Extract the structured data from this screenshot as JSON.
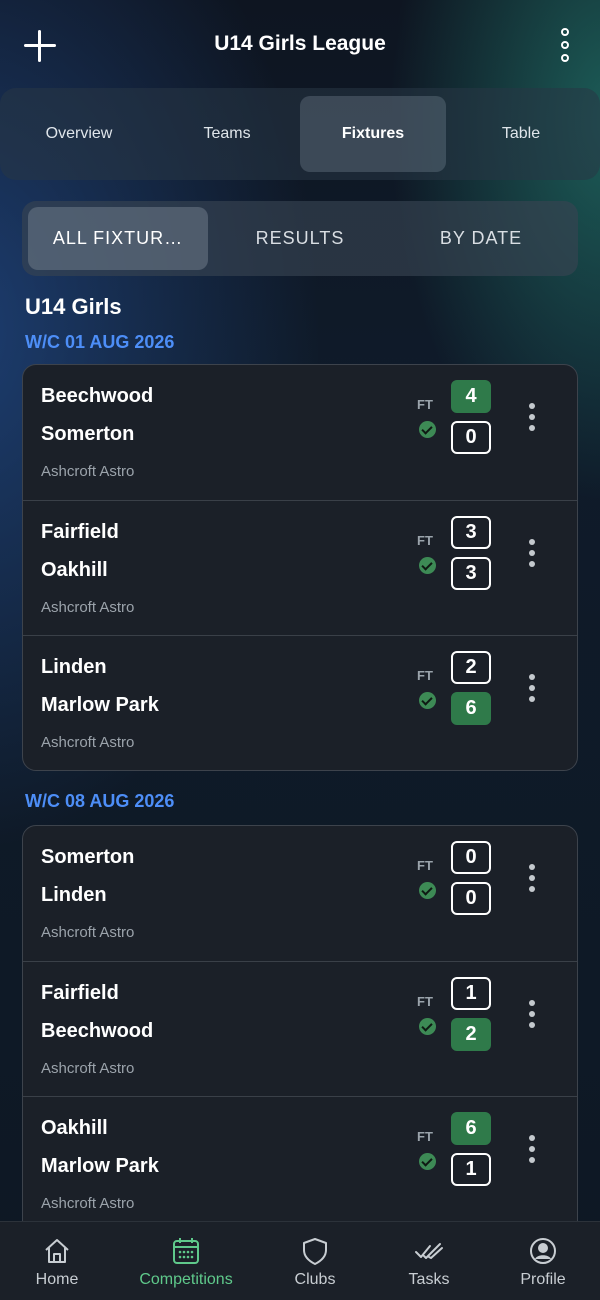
{
  "header": {
    "title": "U14 Girls League"
  },
  "tabs": [
    {
      "label": "Overview",
      "active": false
    },
    {
      "label": "Teams",
      "active": false
    },
    {
      "label": "Fixtures",
      "active": true
    },
    {
      "label": "Table",
      "active": false
    }
  ],
  "segments": [
    {
      "label": "ALL FIXTUR…",
      "active": true
    },
    {
      "label": "RESULTS",
      "active": false
    },
    {
      "label": "BY DATE",
      "active": false
    }
  ],
  "competition": "U14 Girls",
  "weeks": [
    {
      "label": "W/C 01 AUG 2026",
      "fixtures": [
        {
          "home": "Beechwood",
          "away": "Somerton",
          "venue": "Ashcroft Astro",
          "status": "FT",
          "home_score": "4",
          "away_score": "0"
        },
        {
          "home": "Fairfield",
          "away": "Oakhill",
          "venue": "Ashcroft Astro",
          "status": "FT",
          "home_score": "3",
          "away_score": "3"
        },
        {
          "home": "Linden",
          "away": "Marlow Park",
          "venue": "Ashcroft Astro",
          "status": "FT",
          "home_score": "2",
          "away_score": "6"
        }
      ]
    },
    {
      "label": "W/C 08 AUG 2026",
      "fixtures": [
        {
          "home": "Somerton",
          "away": "Linden",
          "venue": "Ashcroft Astro",
          "status": "FT",
          "home_score": "0",
          "away_score": "0"
        },
        {
          "home": "Fairfield",
          "away": "Beechwood",
          "venue": "Ashcroft Astro",
          "status": "FT",
          "home_score": "1",
          "away_score": "2"
        },
        {
          "home": "Oakhill",
          "away": "Marlow Park",
          "venue": "Ashcroft Astro",
          "status": "FT",
          "home_score": "6",
          "away_score": "1"
        }
      ]
    }
  ],
  "bottom_nav": [
    {
      "label": "Home",
      "icon": "home-icon",
      "active": false
    },
    {
      "label": "Competitions",
      "icon": "calendar-icon",
      "active": true
    },
    {
      "label": "Clubs",
      "icon": "shield-icon",
      "active": false
    },
    {
      "label": "Tasks",
      "icon": "double-check-icon",
      "active": false
    },
    {
      "label": "Profile",
      "icon": "profile-icon",
      "active": false
    }
  ],
  "colors": {
    "accent_blue": "#4d8ef7",
    "win_green": "#2f7a4a",
    "nav_active": "#5fc98b",
    "card_bg": "#1b2028"
  }
}
